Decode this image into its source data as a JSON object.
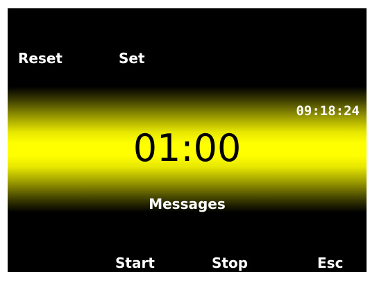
{
  "softkeys": {
    "top_left": "Reset",
    "top_second": "Set",
    "bottom_start": "Start",
    "bottom_stop": "Stop",
    "bottom_esc": "Esc"
  },
  "display": {
    "clock": "09:18:24",
    "timer": "01:00",
    "messages": "Messages"
  },
  "colors": {
    "background": "#000000",
    "band": "#ffff00",
    "label_text": "#ffffff",
    "timer_text": "#000000"
  }
}
